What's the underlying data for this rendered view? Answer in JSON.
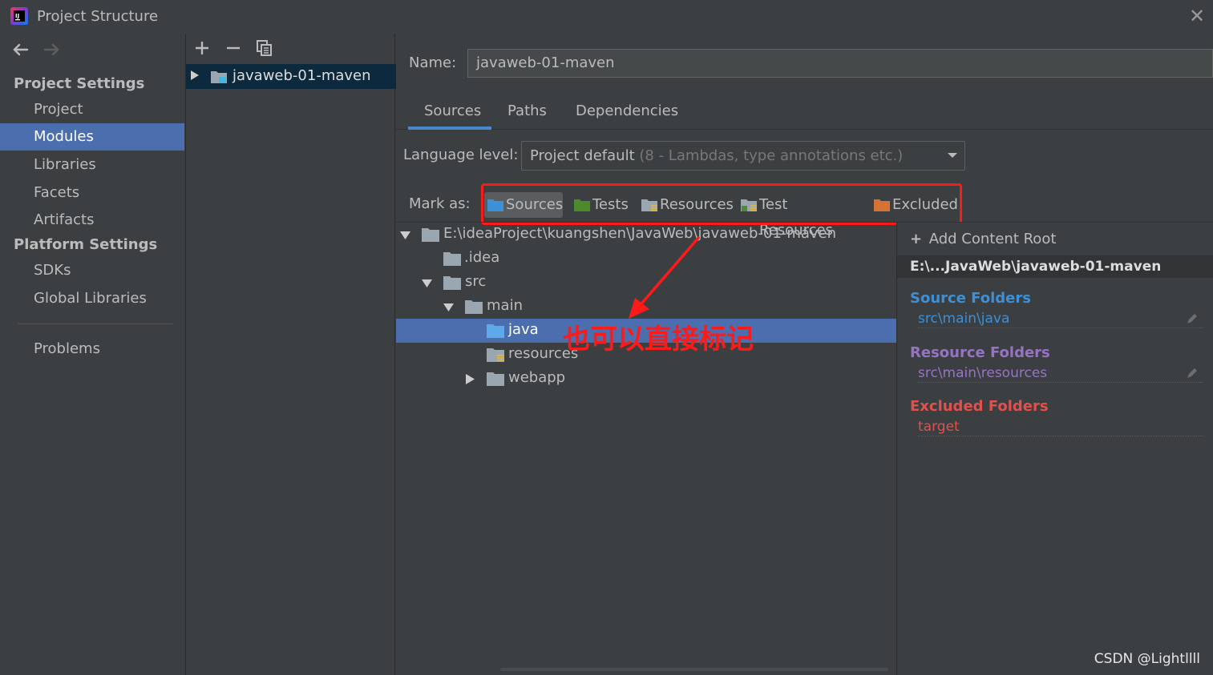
{
  "window": {
    "title": "Project Structure",
    "app_icon": "intellij-icon",
    "close_icon": "close-icon"
  },
  "leftnav": {
    "back_icon": "arrow-left-icon",
    "forward_icon": "arrow-right-icon",
    "project_settings_header": "Project Settings",
    "project_items": [
      "Project",
      "Modules",
      "Libraries",
      "Facets",
      "Artifacts"
    ],
    "platform_settings_header": "Platform Settings",
    "platform_items": [
      "SDKs",
      "Global Libraries"
    ],
    "problems": "Problems",
    "selected": "Modules"
  },
  "modules": {
    "toolbar": [
      "add-icon",
      "remove-icon",
      "copy-icon"
    ],
    "module_name": "javaweb-01-maven"
  },
  "content": {
    "name_label": "Name:",
    "name_value": "javaweb-01-maven",
    "tabs": [
      "Sources",
      "Paths",
      "Dependencies"
    ],
    "active_tab": "Sources",
    "language_label": "Language level:",
    "language_main": "Project default",
    "language_hint": "(8 - Lambdas, type annotations etc.)",
    "mark_as_label": "Mark as:",
    "mark_buttons": [
      "Sources",
      "Tests",
      "Resources",
      "Test Resources",
      "Excluded"
    ],
    "tree": [
      {
        "label": "E:\\ideaProject\\kuangshen\\JavaWeb\\javaweb-01-maven",
        "depth": 0,
        "expanded": true,
        "type": "module"
      },
      {
        "label": ".idea",
        "depth": 1,
        "type": "folder"
      },
      {
        "label": "src",
        "depth": 1,
        "expanded": true,
        "type": "folder"
      },
      {
        "label": "main",
        "depth": 2,
        "expanded": true,
        "type": "folder"
      },
      {
        "label": "java",
        "depth": 3,
        "type": "source",
        "selected": true
      },
      {
        "label": "resources",
        "depth": 3,
        "type": "resource"
      },
      {
        "label": "webapp",
        "depth": 3,
        "expanded": false,
        "type": "folder"
      }
    ],
    "annotation": "也可以直接标记"
  },
  "right_panel": {
    "add_content_root": "Add Content Root",
    "root_path": "E:\\...JavaWeb\\javaweb-01-maven",
    "source_heading": "Source Folders",
    "source_entry": "src\\main\\java",
    "resource_heading": "Resource Folders",
    "resource_entry": "src\\main\\resources",
    "excluded_heading": "Excluded Folders",
    "excluded_entry": "target"
  },
  "colors": {
    "source": "#3d8fd6",
    "resource": "#9773c4",
    "excluded": "#e0504c",
    "selection": "#4b6eaf",
    "annotation": "#ff1a1a"
  },
  "watermark": "CSDN @Lightllll"
}
